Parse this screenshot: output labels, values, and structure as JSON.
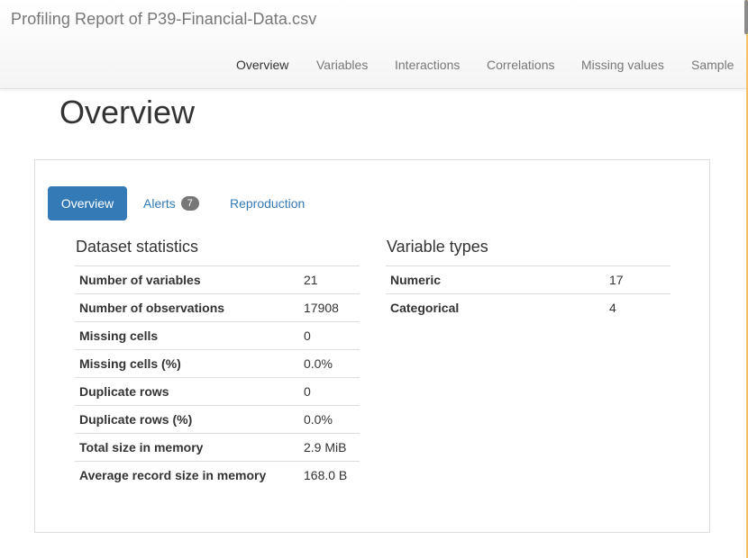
{
  "app": {
    "title": "Profiling Report of P39-Financial-Data.csv"
  },
  "nav": {
    "items": [
      {
        "label": "Overview",
        "active": true
      },
      {
        "label": "Variables"
      },
      {
        "label": "Interactions"
      },
      {
        "label": "Correlations"
      },
      {
        "label": "Missing values"
      },
      {
        "label": "Sample"
      }
    ]
  },
  "page": {
    "title": "Overview"
  },
  "tabs": {
    "overview": "Overview",
    "alerts": "Alerts",
    "alerts_count": "7",
    "reproduction": "Reproduction"
  },
  "dataset_statistics": {
    "title": "Dataset statistics",
    "rows": [
      {
        "key": "Number of variables",
        "value": "21"
      },
      {
        "key": "Number of observations",
        "value": "17908"
      },
      {
        "key": "Missing cells",
        "value": "0"
      },
      {
        "key": "Missing cells (%)",
        "value": "0.0%"
      },
      {
        "key": "Duplicate rows",
        "value": "0"
      },
      {
        "key": "Duplicate rows (%)",
        "value": "0.0%"
      },
      {
        "key": "Total size in memory",
        "value": "2.9 MiB"
      },
      {
        "key": "Average record size in memory",
        "value": "168.0 B"
      }
    ]
  },
  "variable_types": {
    "title": "Variable types",
    "rows": [
      {
        "key": "Numeric",
        "value": "17"
      },
      {
        "key": "Categorical",
        "value": "4"
      }
    ]
  },
  "colors": {
    "accent": "#337ab7",
    "badge": "#777777",
    "nav_text": "#777777"
  }
}
